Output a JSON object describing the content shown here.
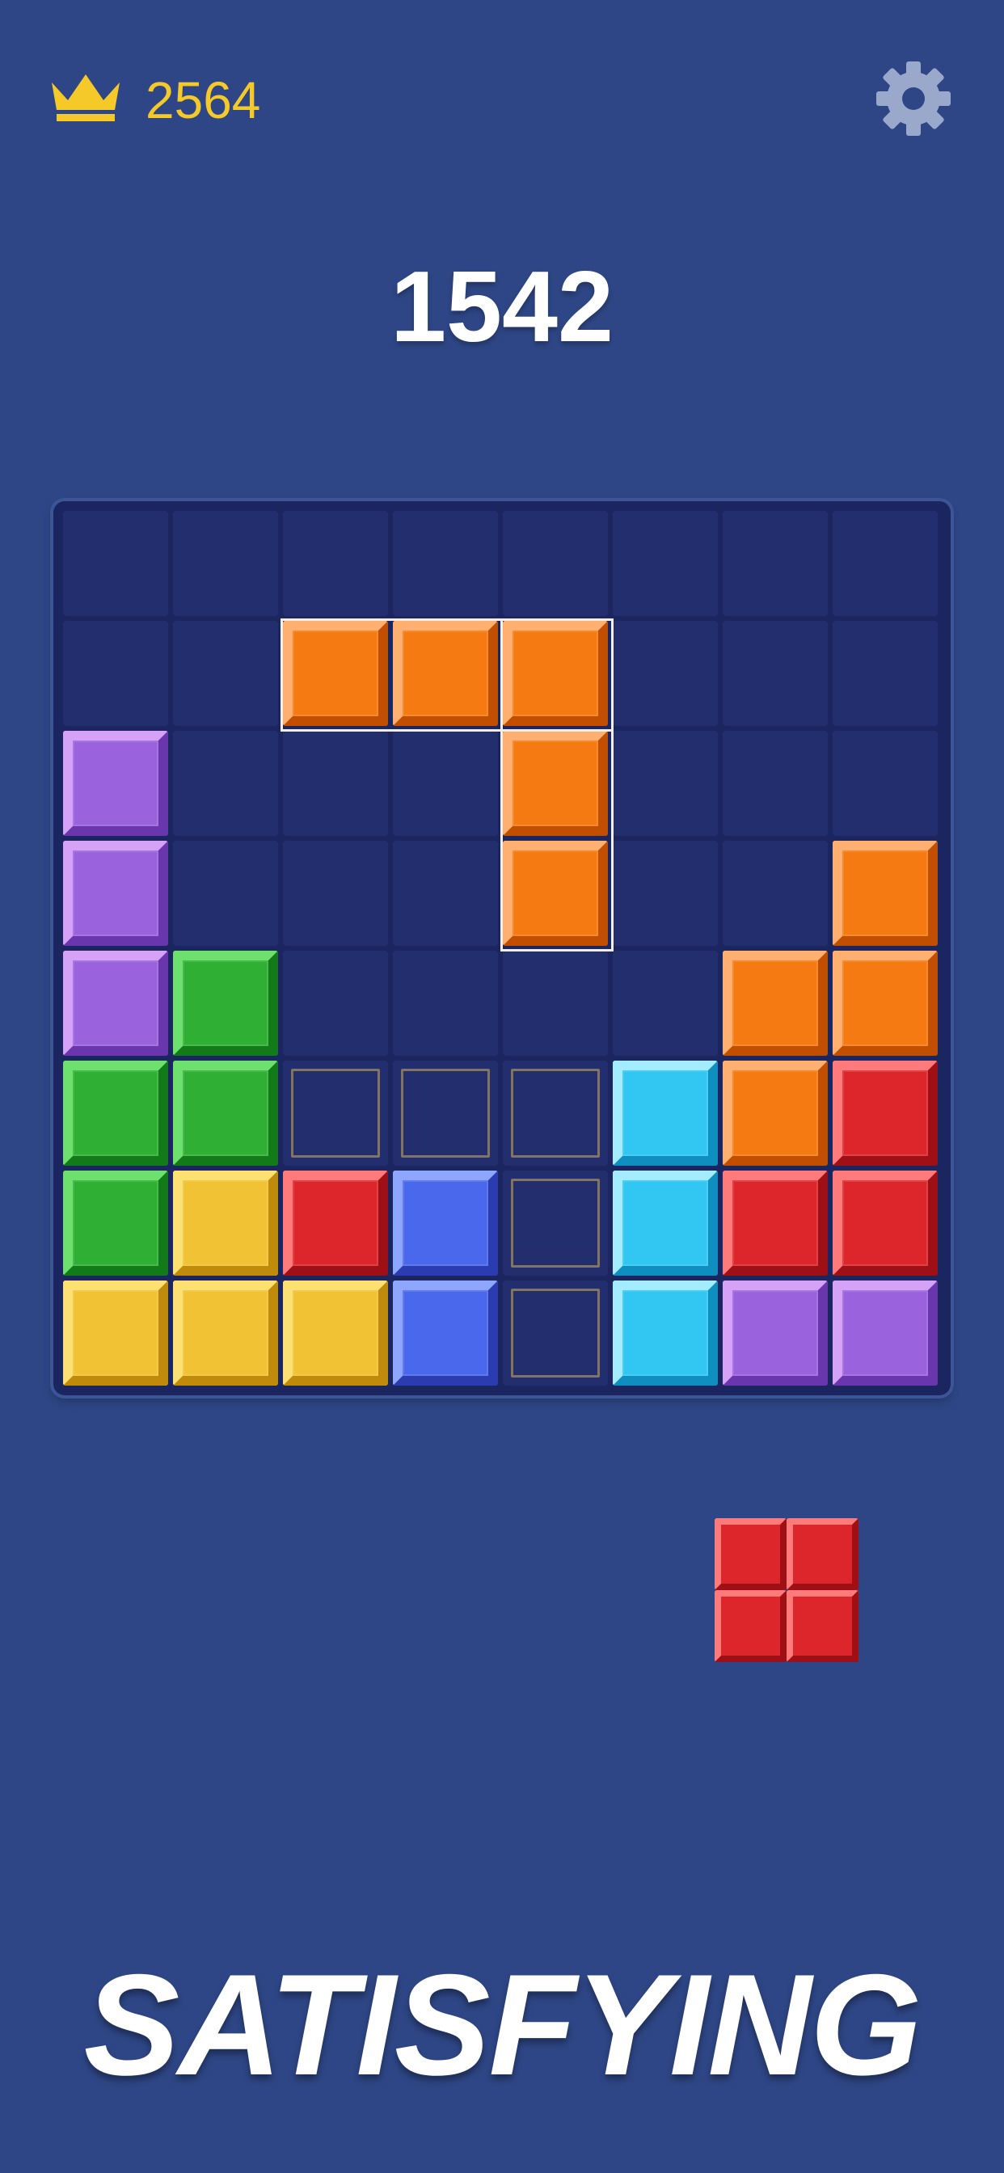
{
  "header": {
    "best_score": "2564",
    "best_icon": "crown-icon",
    "settings_icon": "gear-icon"
  },
  "score": "1542",
  "colors": {
    "background": "#2e4685",
    "board": "#1b2560",
    "empty_cell": "#232e6e",
    "gold_text": "#f5c928"
  },
  "palette": {
    "O": [
      "#ffb071",
      "#f57a12",
      "#c24f00"
    ],
    "P": [
      "#d6a2f7",
      "#9a62dd",
      "#6a36ad"
    ],
    "G": [
      "#6ee06e",
      "#2fb034",
      "#137a19"
    ],
    "Y": [
      "#fde072",
      "#f1c233",
      "#c08a0a"
    ],
    "R": [
      "#ff7b7b",
      "#dd262c",
      "#9e0f16"
    ],
    "B": [
      "#8fa6ff",
      "#4a68ec",
      "#2a3cb0"
    ],
    "C": [
      "#a4ecff",
      "#32c6f2",
      "#0f8fc0"
    ]
  },
  "board": {
    "rows": [
      "........",
      "..OOO...",
      "P...O...",
      "P...O..O",
      "PG....OO",
      "GG...COR",
      "GYRB.CRR",
      "YYYB.CPP"
    ],
    "hint_cells": [
      [
        5,
        2
      ],
      [
        5,
        3
      ],
      [
        5,
        4
      ],
      [
        6,
        4
      ],
      [
        7,
        4
      ]
    ],
    "dragging_piece": "orange-j-piece"
  },
  "next_piece": {
    "color": "R",
    "shape": [
      "RR",
      "RR"
    ]
  },
  "tagline": "SATISFYING"
}
